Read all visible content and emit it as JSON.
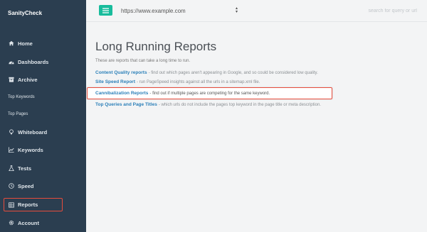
{
  "app": {
    "brand": "SanityCheck"
  },
  "sidebar": {
    "items": [
      {
        "label": "Home",
        "icon": "home-icon"
      },
      {
        "label": "Dashboards",
        "icon": "dashboard-icon"
      },
      {
        "label": "Archive",
        "icon": "archive-icon"
      },
      {
        "label": "Top Keywords",
        "icon": ""
      },
      {
        "label": "Top Pages",
        "icon": ""
      },
      {
        "label": "Whiteboard",
        "icon": "bulb-icon"
      },
      {
        "label": "Keywords",
        "icon": "chart-icon"
      },
      {
        "label": "Tests",
        "icon": "flask-icon"
      },
      {
        "label": "Speed",
        "icon": "clock-icon"
      },
      {
        "label": "Reports",
        "icon": "reports-icon",
        "active": true
      },
      {
        "label": "Account",
        "icon": "gear-icon"
      }
    ]
  },
  "topbar": {
    "url_value": "https://www.example.com",
    "search_placeholder": "search for query or url"
  },
  "main": {
    "title": "Long Running Reports",
    "intro": "These are reports that can take a long time to run.",
    "reports": [
      {
        "name": "Content Quality reports",
        "desc": "- find out which pages aren't appearing in Google, and so could be considered low quality."
      },
      {
        "name": "Site Speed Report",
        "desc": "- run PageSpeed insights against all the urls in a sitemap.xml file."
      },
      {
        "name": "Cannibalization Reports",
        "desc": "- find out if multiple pages are competing for the same keyword.",
        "highlighted": true
      },
      {
        "name": "Top Queries and Page Titles",
        "desc": "- which urls do not include the pages top keyword in the page title or meta description."
      }
    ]
  },
  "colors": {
    "sidebar_bg": "#2b3e50",
    "accent": "#18bc9c",
    "link": "#2c80b9",
    "highlight": "#e74c3c"
  }
}
